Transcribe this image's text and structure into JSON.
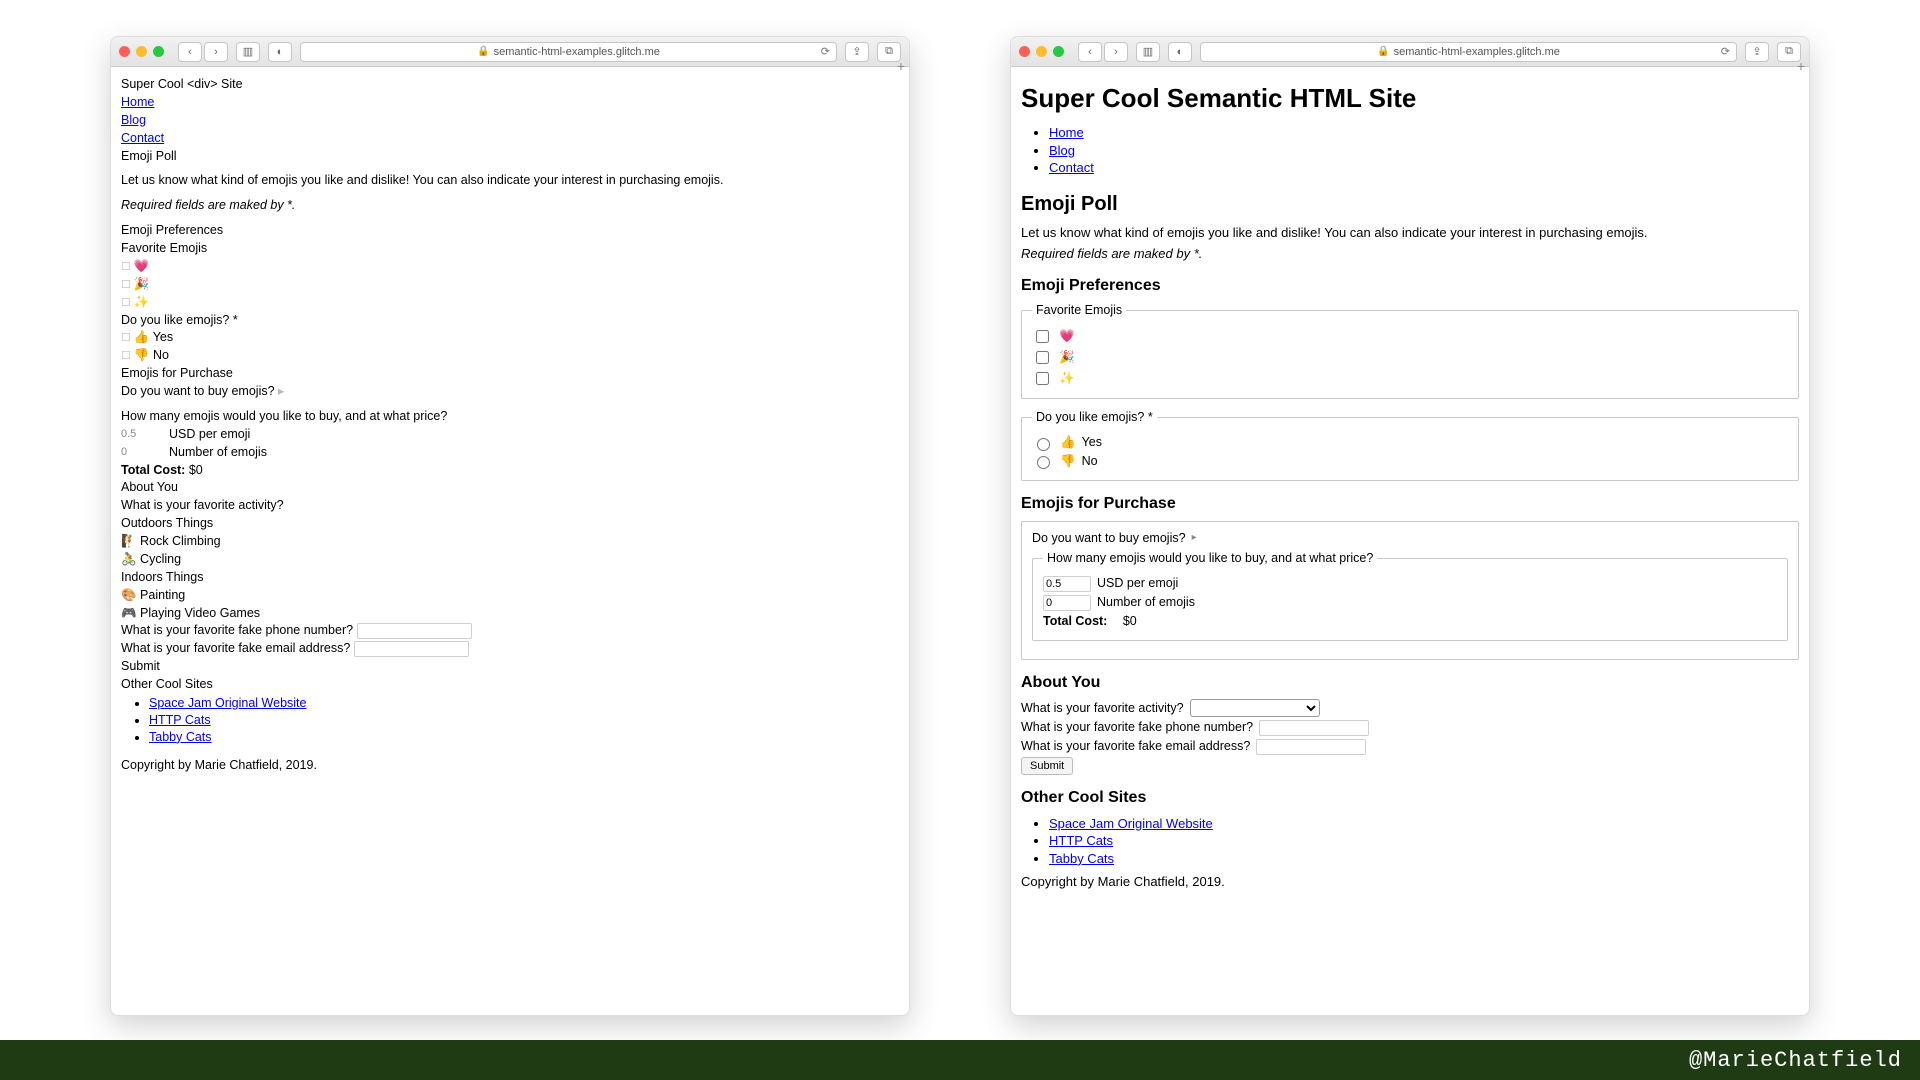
{
  "footer_handle": "@MarieChatfield",
  "browser": {
    "url": "semantic-html-examples.glitch.me"
  },
  "nav_links": {
    "home": "Home",
    "blog": "Blog",
    "contact": "Contact"
  },
  "divsite": {
    "title": "Super Cool <div> Site",
    "poll_heading": "Emoji Poll",
    "intro": "Let us know what kind of emojis you like and dislike! You can also indicate your interest in purchasing emojis.",
    "required_note": "Required fields are maked by *.",
    "prefs_heading": "Emoji Preferences",
    "fav_label": "Favorite Emojis",
    "like_q": "Do you like emojis? *",
    "yes_label": "Yes",
    "no_label": "No",
    "purchase_heading": "Emojis for Purchase",
    "buy_q": "Do you want to buy emojis?",
    "how_many_q": "How many emojis would you like to buy, and at what price?",
    "usd_val": "0.5",
    "usd_label": "USD per emoji",
    "num_val": "0",
    "num_label": "Number of emojis",
    "total_label": "Total Cost:",
    "total_val": "$0",
    "about_heading": "About You",
    "activity_q": "What is your favorite activity?",
    "outdoors_h": "Outdoors Things",
    "opt_rock": "Rock Climbing",
    "opt_cycle": "Cycling",
    "indoors_h": "Indoors Things",
    "opt_paint": "Painting",
    "opt_games": "Playing Video Games",
    "phone_q": "What is your favorite fake phone number?",
    "email_q": "What is your favorite fake email address?",
    "submit": "Submit",
    "other_sites": "Other Cool Sites",
    "links": {
      "spacejam": "Space Jam Original Website",
      "httpcats": "HTTP Cats",
      "tabbycats": "Tabby Cats"
    },
    "copyright": "Copyright by Marie Chatfield, 2019."
  },
  "semsite": {
    "title": "Super Cool Semantic HTML Site",
    "poll_heading": "Emoji Poll",
    "intro": "Let us know what kind of emojis you like and dislike! You can also indicate your interest in purchasing emojis.",
    "required_note": "Required fields are maked by *.",
    "prefs_heading": "Emoji Preferences",
    "fav_legend": "Favorite Emojis",
    "like_legend": "Do you like emojis? *",
    "yes_label": "Yes",
    "no_label": "No",
    "purchase_heading": "Emojis for Purchase",
    "buy_q": "Do you want to buy emojis?",
    "how_many_legend": "How many emojis would you like to buy, and at what price?",
    "usd_val": "0.5",
    "usd_label": "USD per emoji",
    "num_val": "0",
    "num_label": "Number of emojis",
    "total_label": "Total Cost:",
    "total_val": "$0",
    "about_heading": "About You",
    "activity_q": "What is your favorite activity?",
    "phone_q": "What is your favorite fake phone number?",
    "email_q": "What is your favorite fake email address?",
    "submit": "Submit",
    "other_sites": "Other Cool Sites",
    "links": {
      "spacejam": "Space Jam Original Website",
      "httpcats": "HTTP Cats",
      "tabbycats": "Tabby Cats"
    },
    "copyright": "Copyright by Marie Chatfield, 2019."
  }
}
